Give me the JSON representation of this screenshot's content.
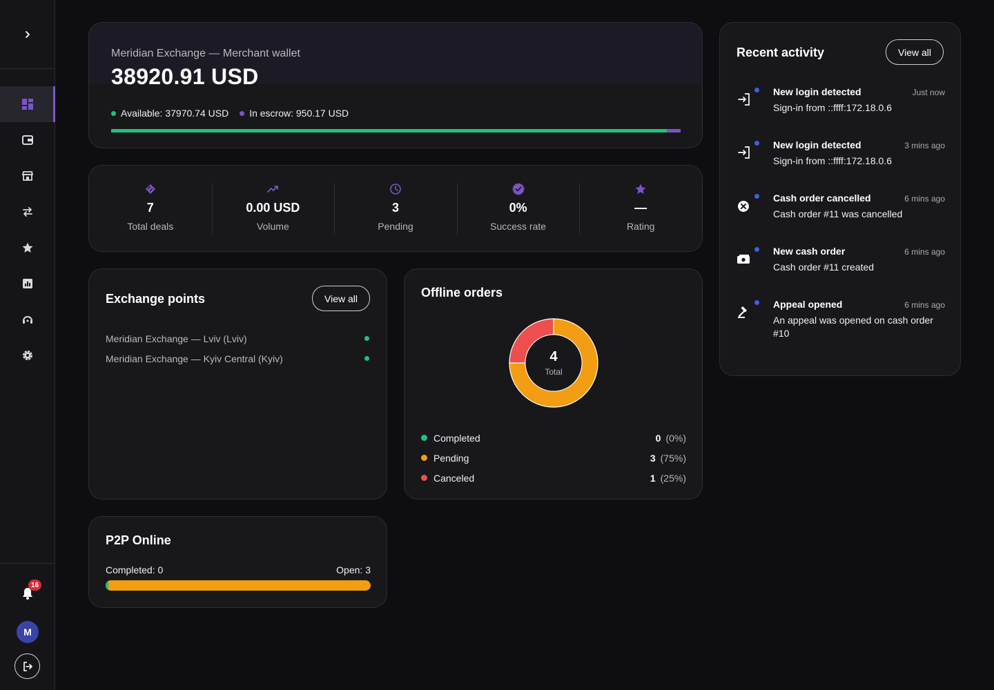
{
  "wallet": {
    "name": "Meridian Exchange — Merchant wallet",
    "amount": "38920.91 USD",
    "available": "Available: 37970.74 USD",
    "escrow": "In escrow: 950.17 USD",
    "available_fraction": 0.9756,
    "colors": {
      "available": "#20c07a",
      "escrow": "#7b55c7"
    }
  },
  "stats": [
    {
      "icon": "diamond-icon",
      "value": "7",
      "label": "Total deals"
    },
    {
      "icon": "trend-up-icon",
      "value": "0.00 USD",
      "label": "Volume"
    },
    {
      "icon": "clock-icon",
      "value": "3",
      "label": "Pending"
    },
    {
      "icon": "verified-badge-icon",
      "value": "0%",
      "label": "Success rate"
    },
    {
      "icon": "star-icon",
      "value": "—",
      "label": "Rating"
    }
  ],
  "exchange_points": {
    "title": "Exchange points",
    "view_all": "View all",
    "items": [
      {
        "name": "Meridian Exchange — Lviv (Lviv)",
        "status": "online"
      },
      {
        "name": "Meridian Exchange — Kyiv Central (Kyiv)",
        "status": "online"
      }
    ]
  },
  "offline_orders": {
    "title": "Offline orders",
    "total": "4",
    "total_label": "Total",
    "legend": [
      {
        "name": "Completed",
        "count": "0",
        "pct": "(0%)",
        "color": "#20c07a",
        "value": 0
      },
      {
        "name": "Pending",
        "count": "3",
        "pct": "(75%)",
        "color": "#f29d12",
        "value": 3
      },
      {
        "name": "Canceled",
        "count": "1",
        "pct": "(25%)",
        "color": "#ef4e4e",
        "value": 1
      }
    ]
  },
  "p2p": {
    "title": "P2P Online",
    "completed": "Completed: 0",
    "open": "Open: 3",
    "completed_fraction": 0.01
  },
  "activity": {
    "title": "Recent activity",
    "view_all": "View all",
    "items": [
      {
        "icon": "login-icon",
        "title": "New login detected",
        "time": "Just now",
        "desc": "Sign-in from ::ffff:172.18.0.6"
      },
      {
        "icon": "login-icon",
        "title": "New login detected",
        "time": "3 mins ago",
        "desc": "Sign-in from ::ffff:172.18.0.6"
      },
      {
        "icon": "cancel-circle-icon",
        "title": "Cash order cancelled",
        "time": "6 mins ago",
        "desc": "Cash order #11 was cancelled"
      },
      {
        "icon": "cash-icon",
        "title": "New cash order",
        "time": "6 mins ago",
        "desc": "Cash order #11 created"
      },
      {
        "icon": "gavel-icon",
        "title": "Appeal opened",
        "time": "6 mins ago",
        "desc": "An appeal was opened on cash order #10"
      }
    ]
  },
  "sidebar": {
    "items": [
      "dashboard-icon",
      "wallet-icon",
      "store-icon",
      "exchange-icon",
      "star-icon",
      "chart-icon",
      "support-icon",
      "settings-icon"
    ],
    "notifications": "16",
    "avatar": "M"
  }
}
